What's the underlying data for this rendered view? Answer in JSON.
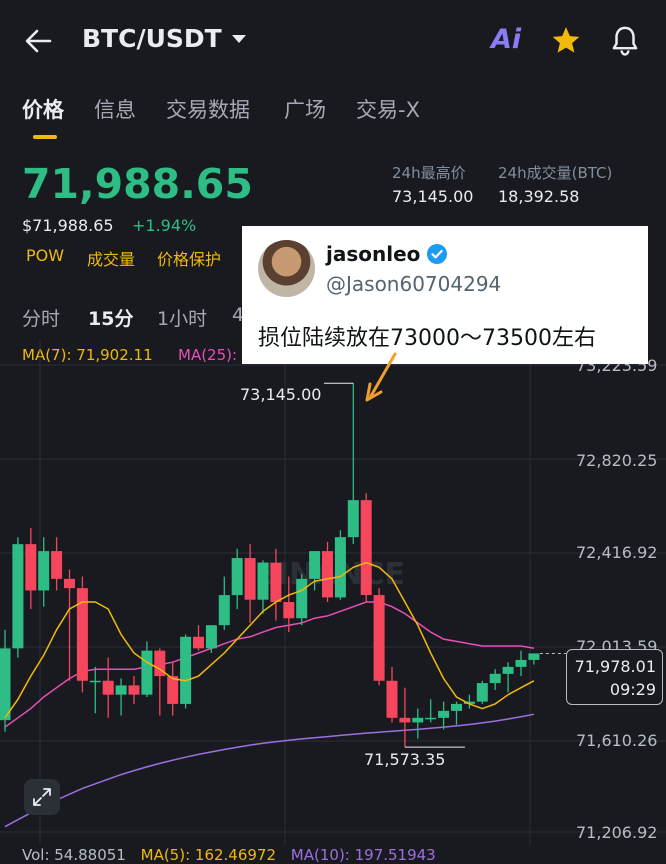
{
  "header": {
    "back_icon": "arrow-left-icon",
    "pair": "BTC/USDT",
    "ai_label": "Ai",
    "star_icon": "star-icon",
    "bell_icon": "bell-icon"
  },
  "tabs": [
    "价格",
    "信息",
    "交易数据",
    "广场",
    "交易-X"
  ],
  "price": {
    "last": "71,988.65",
    "usd": "$71,988.65",
    "change": "+1.94%",
    "tags": [
      "POW",
      "成交量",
      "价格保护"
    ]
  },
  "stats": {
    "high_label": "24h最高价",
    "high_value": "73,145.00",
    "vol_label": "24h成交量(BTC)",
    "vol_value": "18,392.58"
  },
  "intervals": [
    "分时",
    "15分",
    "1小时",
    "4"
  ],
  "ma": {
    "ma7": "MA(7): 71,902.11",
    "ma25": "MA(25): "
  },
  "tweet": {
    "name": "jasonleo",
    "handle": "@Jason60704294",
    "text": "损位陆续放在73000～73500左右"
  },
  "chart_data": {
    "type": "candlestick",
    "y_ticks": [
      "73,223.59",
      "72,820.25",
      "72,416.92",
      "72,013.59",
      "71,610.26",
      "71,206.92"
    ],
    "ylim": [
      71206.92,
      73223.59
    ],
    "high_label": "73,145.00",
    "low_label": "71,573.35",
    "last_price": "71,978.01",
    "countdown": "09:29",
    "watermark": "BINANCE",
    "colors": {
      "up": "#2ebd85",
      "down": "#f6465d",
      "ma7": "#f0b90b",
      "ma25": "#e84fb8",
      "ma99": "#9d6fe0"
    },
    "candles": [
      {
        "o": 71690,
        "h": 72080,
        "l": 71640,
        "c": 72000
      },
      {
        "o": 72000,
        "h": 72480,
        "l": 71960,
        "c": 72450
      },
      {
        "o": 72450,
        "h": 72520,
        "l": 72170,
        "c": 72250
      },
      {
        "o": 72250,
        "h": 72480,
        "l": 72180,
        "c": 72420
      },
      {
        "o": 72420,
        "h": 72480,
        "l": 72250,
        "c": 72300
      },
      {
        "o": 72300,
        "h": 72340,
        "l": 71860,
        "c": 72260
      },
      {
        "o": 72260,
        "h": 72310,
        "l": 71810,
        "c": 71860
      },
      {
        "o": 71860,
        "h": 71920,
        "l": 71720,
        "c": 71860
      },
      {
        "o": 71860,
        "h": 71960,
        "l": 71700,
        "c": 71800
      },
      {
        "o": 71800,
        "h": 71870,
        "l": 71710,
        "c": 71840
      },
      {
        "o": 71840,
        "h": 71880,
        "l": 71760,
        "c": 71800
      },
      {
        "o": 71800,
        "h": 72030,
        "l": 71790,
        "c": 71990
      },
      {
        "o": 71990,
        "h": 72000,
        "l": 71710,
        "c": 71880
      },
      {
        "o": 71880,
        "h": 71940,
        "l": 71710,
        "c": 71760
      },
      {
        "o": 71760,
        "h": 72060,
        "l": 71740,
        "c": 72050
      },
      {
        "o": 72050,
        "h": 72100,
        "l": 71990,
        "c": 72000
      },
      {
        "o": 72000,
        "h": 72100,
        "l": 71980,
        "c": 72100
      },
      {
        "o": 72100,
        "h": 72310,
        "l": 72080,
        "c": 72230
      },
      {
        "o": 72230,
        "h": 72430,
        "l": 72170,
        "c": 72390
      },
      {
        "o": 72390,
        "h": 72450,
        "l": 72110,
        "c": 72210
      },
      {
        "o": 72210,
        "h": 72380,
        "l": 72150,
        "c": 72370
      },
      {
        "o": 72370,
        "h": 72430,
        "l": 72120,
        "c": 72200
      },
      {
        "o": 72200,
        "h": 72310,
        "l": 72070,
        "c": 72130
      },
      {
        "o": 72130,
        "h": 72320,
        "l": 72100,
        "c": 72300
      },
      {
        "o": 72300,
        "h": 72420,
        "l": 72250,
        "c": 72420
      },
      {
        "o": 72420,
        "h": 72460,
        "l": 72200,
        "c": 72220
      },
      {
        "o": 72220,
        "h": 72510,
        "l": 72210,
        "c": 72480
      },
      {
        "o": 72480,
        "h": 73145,
        "l": 72450,
        "c": 72640
      },
      {
        "o": 72640,
        "h": 72670,
        "l": 72200,
        "c": 72230
      },
      {
        "o": 72230,
        "h": 72260,
        "l": 71840,
        "c": 71860
      },
      {
        "o": 71860,
        "h": 71920,
        "l": 71680,
        "c": 71700
      },
      {
        "o": 71700,
        "h": 71830,
        "l": 71573.35,
        "c": 71680
      },
      {
        "o": 71680,
        "h": 71740,
        "l": 71610,
        "c": 71700
      },
      {
        "o": 71700,
        "h": 71780,
        "l": 71680,
        "c": 71700
      },
      {
        "o": 71700,
        "h": 71770,
        "l": 71650,
        "c": 71730
      },
      {
        "o": 71730,
        "h": 71770,
        "l": 71670,
        "c": 71760
      },
      {
        "o": 71760,
        "h": 71800,
        "l": 71740,
        "c": 71770
      },
      {
        "o": 71770,
        "h": 71860,
        "l": 71760,
        "c": 71850
      },
      {
        "o": 71850,
        "h": 71910,
        "l": 71820,
        "c": 71890
      },
      {
        "o": 71890,
        "h": 71940,
        "l": 71810,
        "c": 71920
      },
      {
        "o": 71920,
        "h": 71990,
        "l": 71880,
        "c": 71950
      },
      {
        "o": 71950,
        "h": 71970,
        "l": 71930,
        "c": 71978
      }
    ],
    "ma7": [
      71700,
      71780,
      71880,
      71970,
      72080,
      72170,
      72200,
      72200,
      72170,
      72060,
      71980,
      71940,
      71910,
      71870,
      71860,
      71880,
      71930,
      71980,
      72040,
      72100,
      72160,
      72200,
      72230,
      72250,
      72290,
      72300,
      72310,
      72350,
      72370,
      72350,
      72300,
      72200,
      72100,
      71980,
      71870,
      71790,
      71760,
      71740,
      71760,
      71800,
      71830,
      71860
    ],
    "ma25": [
      71660,
      71700,
      71740,
      71790,
      71830,
      71870,
      71900,
      71910,
      71910,
      71910,
      71910,
      71920,
      71930,
      71940,
      71960,
      71980,
      72000,
      72020,
      72040,
      72050,
      72070,
      72090,
      72100,
      72110,
      72130,
      72140,
      72160,
      72180,
      72200,
      72200,
      72180,
      72150,
      72110,
      72070,
      72040,
      72030,
      72020,
      72010,
      72010,
      72010,
      72010,
      72000
    ],
    "ma99": [
      71230,
      71260,
      71290,
      71320,
      71345,
      71370,
      71395,
      71415,
      71435,
      71455,
      71472,
      71488,
      71503,
      71517,
      71530,
      71542,
      71553,
      71563,
      71573,
      71582,
      71590,
      71597,
      71603,
      71609,
      71614,
      71619,
      71624,
      71629,
      71634,
      71638,
      71642,
      71646,
      71650,
      71655,
      71660,
      71665,
      71671,
      71678,
      71686,
      71695,
      71705,
      71715
    ]
  },
  "volume_bar": {
    "vol": "Vol: 54.88051",
    "ma5": "MA(5): 162.46972",
    "ma10": "MA(10): 197.51943"
  }
}
